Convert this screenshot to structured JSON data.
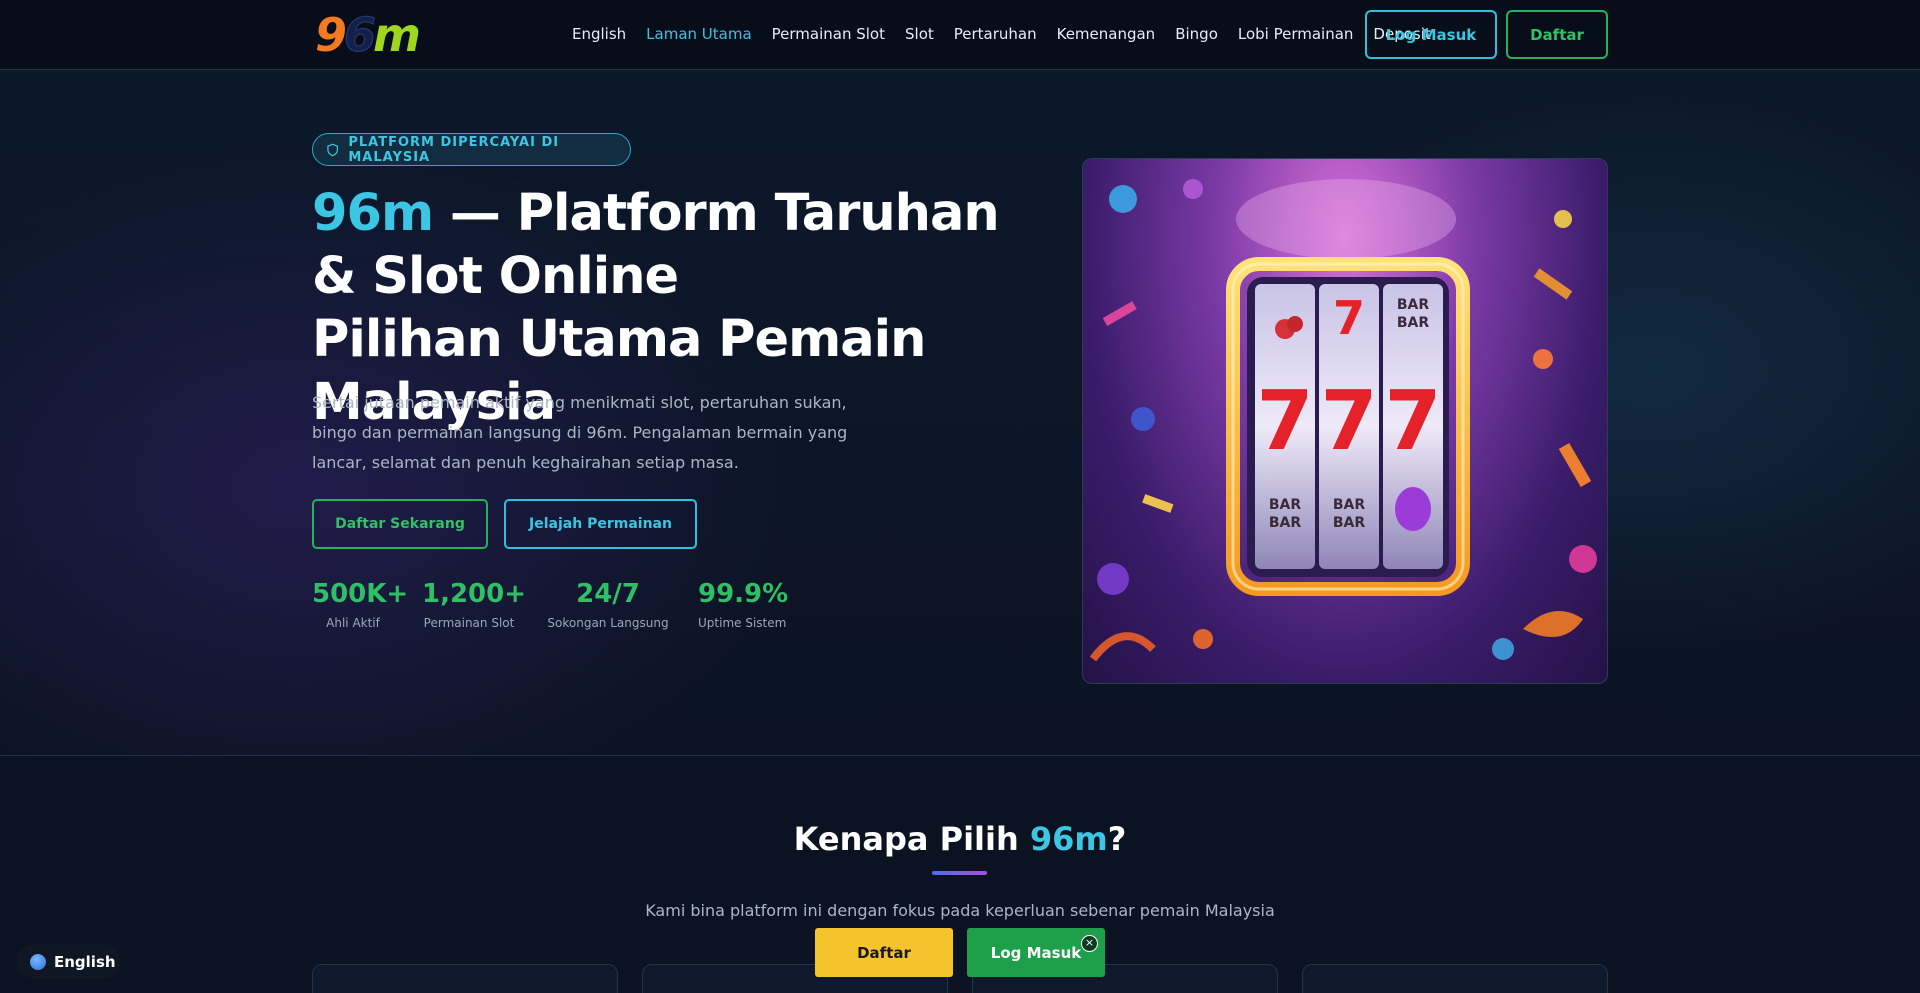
{
  "header": {
    "logo_text": "96m",
    "nav": [
      {
        "label": "English",
        "active": false
      },
      {
        "label": "Laman Utama",
        "active": true
      },
      {
        "label": "Permainan Slot",
        "active": false
      },
      {
        "label": "Slot",
        "active": false
      },
      {
        "label": "Pertaruhan",
        "active": false
      },
      {
        "label": "Kemenangan",
        "active": false
      },
      {
        "label": "Bingo",
        "active": false
      },
      {
        "label": "Lobi Permainan",
        "active": false
      },
      {
        "label": "Deposit",
        "active": false
      }
    ],
    "login_label": "Log Masuk",
    "register_label": "Daftar"
  },
  "hero": {
    "badge": "PLATFORM DIPERCAYAI DI MALAYSIA",
    "title_accent": "96m",
    "title_line1": " — Platform Taruhan & Slot Online",
    "title_line2": "Pilihan Utama Pemain Malaysia",
    "description": "Sertai jutaan pemain aktif yang menikmati slot, pertaruhan sukan, bingo dan permainan langsung di 96m. Pengalaman bermain yang lancar, selamat dan penuh keghairahan setiap masa.",
    "cta_register": "Daftar Sekarang",
    "cta_explore": "Jelajah Permainan",
    "stats": [
      {
        "value": "500K+",
        "label": "Ahli Aktif"
      },
      {
        "value": "1,200+",
        "label": "Permainan Slot"
      },
      {
        "value": "24/7",
        "label": "Sokongan Langsung"
      },
      {
        "value": "99.9%",
        "label": "Uptime Sistem"
      }
    ]
  },
  "why": {
    "title_prefix": "Kenapa Pilih ",
    "title_accent": "96m",
    "title_suffix": "?",
    "subtitle": "Kami bina platform ini dengan fokus pada keperluan sebenar pemain Malaysia"
  },
  "floating": {
    "language": "English",
    "register_label": "Daftar",
    "login_label": "Log Masuk",
    "close_symbol": "×"
  },
  "colors": {
    "accent_cyan": "#3bc6e3",
    "accent_green": "#2fbf64",
    "float_yellow": "#f5c32c",
    "background": "#0a1220"
  }
}
